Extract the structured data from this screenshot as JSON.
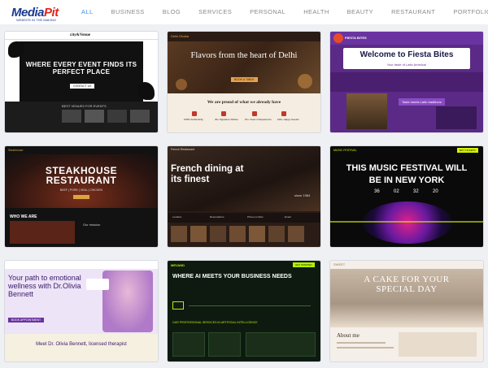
{
  "brand": {
    "name_a": "Media",
    "name_b": "Pit",
    "tagline": "WEBSITE IN THE MAKING"
  },
  "nav": [
    "ALL",
    "BUSINESS",
    "BLOG",
    "SERVICES",
    "PERSONAL",
    "HEALTH",
    "BEAUTY",
    "RESTAURANT",
    "PORTFOLIO"
  ],
  "colors": {
    "active_nav": "#3c8ee8",
    "nav": "#8a8a8a",
    "background": "#eef0f3"
  },
  "cards": {
    "event": {
      "brand": "city&Venue",
      "headline": "WHERE EVERY EVENT FINDS ITS PERFECT PLACE",
      "cta": "CONTACT US",
      "section": "BEST VENUES FOR EVENTS"
    },
    "delhi": {
      "brand": "Delhi Dhaba",
      "headline": "Flavors from the heart of Delhi",
      "cta": "BOOK A TABLE",
      "section": "We are proud of what we already have",
      "stats": [
        "100% Authenticity",
        "40+ Signature Dishes",
        "15+ Years of Experience",
        "100+ Happy Guests"
      ]
    },
    "fiesta": {
      "brand": "FIESTA BITES",
      "headline": "Welcome to Fiesta Bites",
      "sub": "Your taste of Latin America!",
      "label": "Taste meets Latin traditions"
    },
    "steak": {
      "brand": "Steakhouse",
      "headline": "STEAKHOUSE RESTAURANT",
      "tagline": "BEEF | PORK | VEAL | CHICKEN",
      "section": "WHO WE ARE",
      "sub": "Our mission"
    },
    "french": {
      "brand": "French Restaurant",
      "headline": "French dining at its finest",
      "since": "since 1984",
      "labels": [
        "Location",
        "Reservations",
        "Phone number",
        "Email"
      ]
    },
    "music": {
      "brand": "MUSIC FESTIVAL",
      "line1": "THIS MUSIC FESTIVAL WILL",
      "line2": "BE IN NEW YORK",
      "cta": "BUY TICKETS",
      "countdown": [
        "36",
        "02",
        "32",
        "20"
      ]
    },
    "therapist": {
      "headline": "Your path to emotional wellness with Dr.Olivia Bennett",
      "cta": "BOOK APPOINTMENT",
      "meet": "Meet Dr. Olivia Bennett, licensed therapist"
    },
    "ai": {
      "brand": "MEVAND",
      "headline": "WHERE AI MEETS YOUR BUSINESS NEEDS",
      "cta": "GET STARTED",
      "section": "OUR PROFESSIONAL SERVICES IN ARTIFICIAL INTELLIGENCE"
    },
    "cake": {
      "brand": "SWEET",
      "headline": "A CAKE FOR YOUR SPECIAL DAY",
      "section": "About me"
    }
  }
}
